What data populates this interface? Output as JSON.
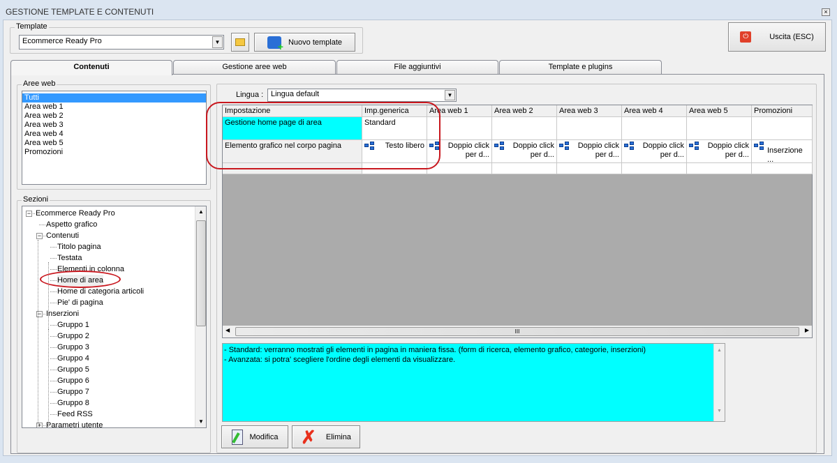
{
  "window": {
    "title": "GESTIONE TEMPLATE E CONTENUTI"
  },
  "template": {
    "group_label": "Template",
    "selected": "Ecommerce Ready Pro",
    "new_button": "Nuovo template"
  },
  "exit_button": "Uscita (ESC)",
  "tabs": [
    {
      "label": "Contenuti",
      "selected": true
    },
    {
      "label": "Gestione aree web"
    },
    {
      "label": "File aggiuntivi"
    },
    {
      "label": "Template e plugins"
    }
  ],
  "aree_web": {
    "label": "Aree web",
    "items": [
      "Tutti",
      "Area web 1",
      "Area web 2",
      "Area web 3",
      "Area web 4",
      "Area web 5",
      "Promozioni"
    ],
    "selected": "Tutti"
  },
  "sezioni": {
    "label": "Sezioni",
    "items": [
      {
        "label": "Ecommerce Ready Pro",
        "level": 0,
        "exp": "−"
      },
      {
        "label": "Aspetto grafico",
        "level": 1
      },
      {
        "label": "Contenuti",
        "level": 1,
        "exp": "−"
      },
      {
        "label": "Titolo pagina",
        "level": 2
      },
      {
        "label": "Testata",
        "level": 2
      },
      {
        "label": "Elementi in colonna",
        "level": 2
      },
      {
        "label": "Home di area",
        "level": 2
      },
      {
        "label": "Home di categoria articoli",
        "level": 2
      },
      {
        "label": "Pie' di pagina",
        "level": 2
      },
      {
        "label": "Inserzioni",
        "level": 1,
        "exp": "−"
      },
      {
        "label": "Gruppo 1",
        "level": 2
      },
      {
        "label": "Gruppo 2",
        "level": 2
      },
      {
        "label": "Gruppo 3",
        "level": 2
      },
      {
        "label": "Gruppo 4",
        "level": 2
      },
      {
        "label": "Gruppo 5",
        "level": 2
      },
      {
        "label": "Gruppo 6",
        "level": 2
      },
      {
        "label": "Gruppo 7",
        "level": 2
      },
      {
        "label": "Gruppo 8",
        "level": 2
      },
      {
        "label": "Feed RSS",
        "level": 2
      },
      {
        "label": "Parametri utente",
        "level": 1,
        "exp": "+"
      }
    ]
  },
  "lingua": {
    "label": "Lingua :",
    "selected": "Lingua default"
  },
  "grid": {
    "columns": [
      "Impostazione",
      "Imp.generica",
      "Area web 1",
      "Area web 2",
      "Area web 3",
      "Area web 4",
      "Area web 5",
      "Promozioni"
    ],
    "rows": [
      {
        "cells": [
          "Gestione home page di area",
          "Standard",
          "",
          "",
          "",
          "",
          "",
          ""
        ]
      },
      {
        "cells": [
          "Elemento grafico nel corpo pagina",
          "Testo libero",
          "Doppio click per d...",
          "Doppio click per d...",
          "Doppio click per d...",
          "Doppio click per d...",
          "Doppio click per d...",
          "Inserzione ..."
        ]
      },
      {
        "cells": [
          "",
          "",
          "",
          "",
          "",
          "",
          "",
          ""
        ]
      }
    ]
  },
  "description": [
    "- Standard: verranno mostrati gli elementi in pagina in maniera fissa. (form di ricerca, elemento grafico, categorie, inserzioni)",
    "- Avanzata: si potra' scegliere l'ordine degli elementi da visualizzare."
  ],
  "buttons": {
    "modifica": "Modifica",
    "elimina": "Elimina"
  },
  "colors": {
    "highlight": "#00ffff",
    "selection": "#3399ff",
    "annotation": "#c8171e"
  }
}
